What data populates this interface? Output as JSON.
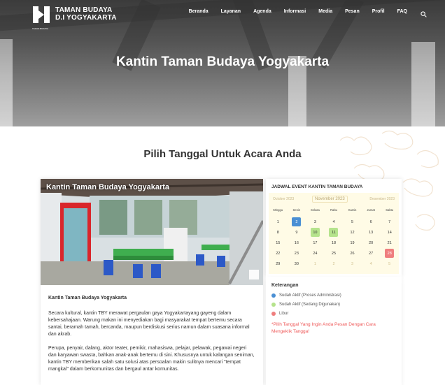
{
  "brand": {
    "line1": "TAMAN BUDAYA",
    "line2": "D.I YOGYAKARTA",
    "mark_caption": "TAMAN BUDAYA"
  },
  "nav": [
    "Beranda",
    "Layanan",
    "Agenda",
    "Informasi",
    "Media",
    "Pesan",
    "Profil",
    "FAQ"
  ],
  "hero": {
    "title": "Kantin Taman Budaya Yogyakarta"
  },
  "section_title": "Pilih Tanggal Untuk Acara Anda",
  "card": {
    "photo_title": "Kantin Taman Budaya Yogyakarta",
    "heading": "Kantin Taman Budaya Yogyakarta",
    "para1": "Secara kultural, kantin TBY merawat pergaulan gaya Yogyakartayang gayeng dalam kebersahajaan. Warung makan ini menyediakan bagi masyarakat tempat bertemu secara santai, beramah tamah, bercanda, maupun berdiskusi serius namun dalam suasana informal dan akrab.",
    "para2": "Perupa, penyair, dalang, aktor teater, pemikir, mahasiswa, pelajar, pelawak, pegawai negeri dan karyawan swasta, bahkan anak-anak bertemu di sini. Khususnya untuk kalangan seniman, kantin TBY memberikan salah satu solusi atas persoalan makin sulitnya mencari \"tempat mangkal\" dalam berkomunitas dan bergaul antar komunitas."
  },
  "calendar": {
    "title": "JADWAL EVENT KANTIN TAMAN BUDAYA",
    "prev_month": "October 2023",
    "current_month": "November 2023",
    "next_month": "Desember 2023",
    "weekdays": [
      "Minggu",
      "Senin",
      "Selasa",
      "Rabu",
      "Kamis",
      "Jumat",
      "Sabtu"
    ],
    "weeks": [
      [
        {
          "d": "1"
        },
        {
          "d": "2",
          "s": "blue"
        },
        {
          "d": "3"
        },
        {
          "d": "4"
        },
        {
          "d": "5"
        },
        {
          "d": "6"
        },
        {
          "d": "7"
        }
      ],
      [
        {
          "d": "8"
        },
        {
          "d": "9"
        },
        {
          "d": "10",
          "s": "green"
        },
        {
          "d": "11",
          "s": "green"
        },
        {
          "d": "12"
        },
        {
          "d": "13"
        },
        {
          "d": "14"
        }
      ],
      [
        {
          "d": "15"
        },
        {
          "d": "16"
        },
        {
          "d": "17"
        },
        {
          "d": "18"
        },
        {
          "d": "19"
        },
        {
          "d": "20"
        },
        {
          "d": "21"
        }
      ],
      [
        {
          "d": "22"
        },
        {
          "d": "23"
        },
        {
          "d": "24"
        },
        {
          "d": "25"
        },
        {
          "d": "26"
        },
        {
          "d": "27"
        },
        {
          "d": "28",
          "s": "red"
        }
      ],
      [
        {
          "d": "29"
        },
        {
          "d": "30"
        },
        {
          "d": "1",
          "s": "other"
        },
        {
          "d": "2",
          "s": "other"
        },
        {
          "d": "3",
          "s": "other"
        },
        {
          "d": "4",
          "s": "other"
        },
        {
          "d": "5",
          "s": "other"
        }
      ]
    ]
  },
  "legend": {
    "title": "Keterangan",
    "items": [
      {
        "label": "Sudah Aktif (Proses Administrasi)",
        "color": "#4a8fd4"
      },
      {
        "label": "Sudah Aktif (Sedang Digunakan)",
        "color": "#b5e38c"
      },
      {
        "label": "Libur",
        "color": "#ef7e7e"
      }
    ],
    "note": "*Pilih Tanggal Yang Ingin Anda Pesan Dengan Cara Mengeklik Tangga!"
  }
}
